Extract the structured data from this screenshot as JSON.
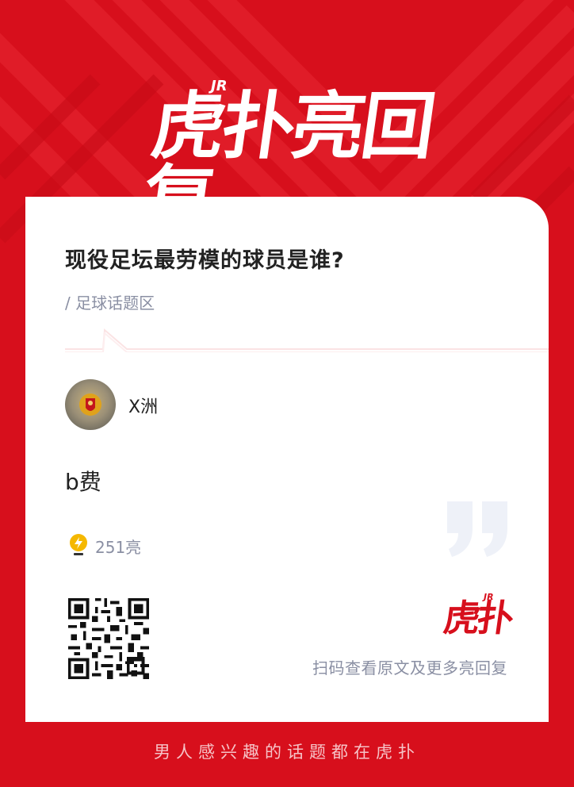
{
  "header": {
    "logo_text": "虎扑亮回复",
    "logo_badge": "JR"
  },
  "post": {
    "title": "现役足坛最劳模的球员是谁?",
    "section": "/ 足球话题区"
  },
  "reply": {
    "username": "X洲",
    "content": "b费",
    "lights": "251亮"
  },
  "share": {
    "brand_logo_text": "虎扑",
    "brand_logo_badge": "JR",
    "scan_hint": "扫码查看原文及更多亮回复"
  },
  "footer": {
    "slogan": "男人感兴趣的话题都在虎扑"
  },
  "colors": {
    "brand_red": "#d70f1c",
    "light_yellow": "#f5b800",
    "muted_text": "#8a8fa3"
  }
}
